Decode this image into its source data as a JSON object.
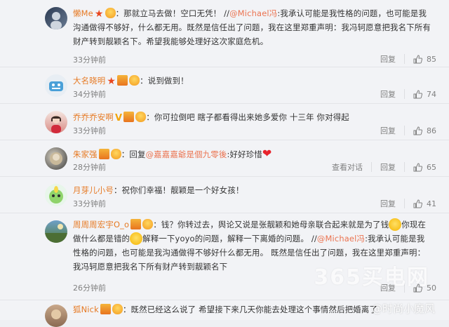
{
  "comments": [
    {
      "author": "懒Me",
      "badges": [
        "red-star-icon",
        "lightbulb-icon"
      ],
      "prefix": "：那就立马去做！空口无凭！ //",
      "mention": "@Michael冯",
      "text": ":我承认可能是我性格的问题，也可能是我沟通做得不够好，什么都无用。既然是信任出了问题，我在这里郑重声明：我冯轲愿意把我名下所有财产转到靓颖名下。希望我能够处理好这次家庭危机。",
      "time": "33分钟前",
      "reply_label": "回复",
      "likes": "85"
    },
    {
      "author": "大名晓明",
      "badges": [
        "red-star-icon",
        "vip-icon",
        "lightbulb-icon"
      ],
      "text": "：说到做到！",
      "time": "34分钟前",
      "reply_label": "回复",
      "likes": "74"
    },
    {
      "author": "乔乔乔安啊",
      "badges": [
        "v-icon",
        "vip-icon",
        "lightbulb-icon"
      ],
      "text": "：你可拉倒吧 瞎子都看得出来她多爱你 十三年 你对得起",
      "time": "33分钟前",
      "reply_label": "回复",
      "likes": "86"
    },
    {
      "author": "朱家强",
      "badges": [
        "vip-icon",
        "lightbulb-icon"
      ],
      "prefix": "：回复",
      "mention": "@嘉嘉嘉爺是個九零後",
      "text": ":好好珍惜",
      "time": "28分钟前",
      "view_replies": "查看对话",
      "reply_label": "回复",
      "likes": "65"
    },
    {
      "author": "月芽儿小号",
      "badges": [],
      "text": "：祝你们幸福！靓颖是一个好女孩！",
      "time": "33分钟前",
      "reply_label": "回复",
      "likes": "41"
    },
    {
      "author": "周周周宏宇O_o",
      "badges": [
        "vip-icon",
        "lightbulb-icon"
      ],
      "text_a": "：钱？你转过去，舆论又说是张靓颖和她母亲联合起来就是为了钱",
      "text_b": "你现在做什么都是错的",
      "text_c": "解释一下yoyo的问题，解释一下离婚的问题。 //",
      "mention": "@Michael冯",
      "text_d": ":我承认可能是我性格的问题，也可能是我沟通做得不够好什么都无用。 既然是信任出了问题，我在这里郑重声明：我冯轲愿意把我名下所有财产转到靓颖名下",
      "time": "26分钟前",
      "reply_label": "回复",
      "likes": "50"
    },
    {
      "author": "狐Nick",
      "badges": [
        "vip-icon",
        "lightbulb-icon"
      ],
      "text": "：既然已经这么说了 希望接下来几天你能去处理这个事情然后把婚离了",
      "time": "",
      "reply_label": "",
      "likes": ""
    }
  ],
  "watermark": {
    "site": "365买电网",
    "handle": "@时尚小魔风"
  }
}
